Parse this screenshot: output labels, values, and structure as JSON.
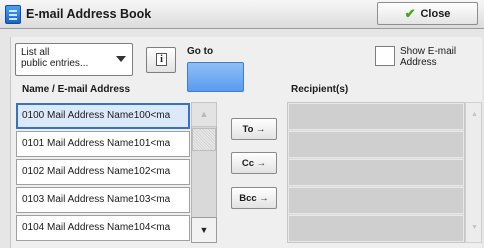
{
  "window": {
    "title": "E-mail Address Book",
    "close_label": "Close"
  },
  "filter": {
    "dropdown_line1": "List all",
    "dropdown_line2": "public entries...",
    "info_icon": "i"
  },
  "goto": {
    "label": "Go to",
    "value": ""
  },
  "show_email": {
    "line1": "Show E-mail",
    "line2": "Address",
    "checked": false
  },
  "list": {
    "header": "Name / E-mail Address",
    "rows": [
      {
        "text": "0100  Mail Address Name100<ma",
        "selected": true
      },
      {
        "text": "0101  Mail Address Name101<ma",
        "selected": false
      },
      {
        "text": "0102  Mail Address Name102<ma",
        "selected": false
      },
      {
        "text": "0103  Mail Address Name103<ma",
        "selected": false
      },
      {
        "text": "0104  Mail Address Name104<ma",
        "selected": false
      }
    ]
  },
  "actions": {
    "to": "To →",
    "cc": "Cc →",
    "bcc": "Bcc →"
  },
  "recipients": {
    "header": "Recipient(s)",
    "rows": [
      "",
      "",
      "",
      "",
      ""
    ]
  },
  "colors": {
    "accent": "#3672c9",
    "goto_fill": "#5a9bf0",
    "close_check": "#4aa51b"
  },
  "icons": {
    "title": "address-book-icon",
    "close": "checkmark-icon"
  }
}
